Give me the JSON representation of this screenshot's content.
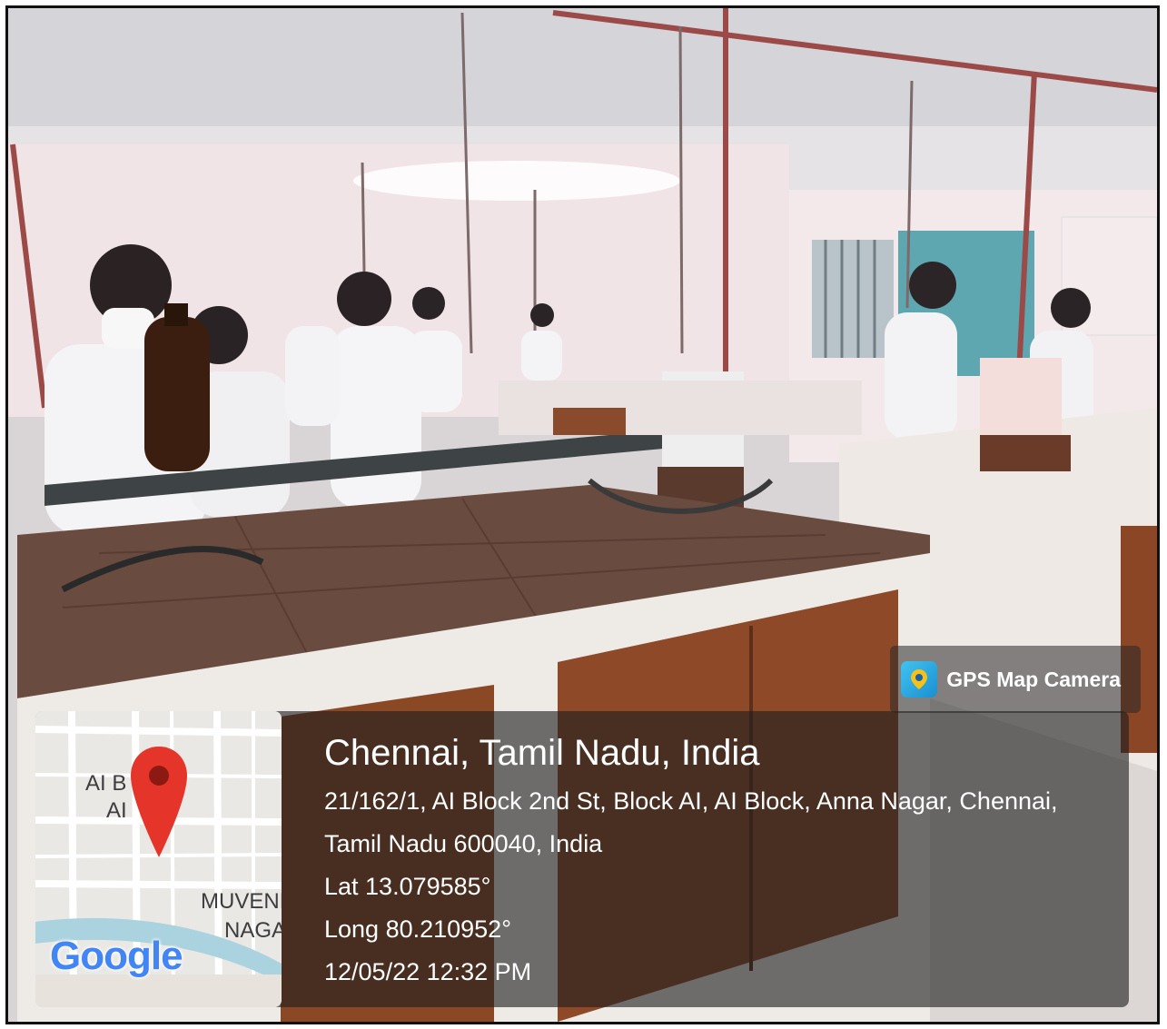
{
  "badge": {
    "app_name": "GPS Map Camera",
    "logo_icon": "camera-pin-icon"
  },
  "map": {
    "label_1": "AI B",
    "label_2": "AI",
    "label_3": "MUVENI",
    "label_4": "NAGA",
    "provider": "Google",
    "marker_icon": "red-map-pin-icon"
  },
  "location": {
    "city": "Chennai, Tamil Nadu, India",
    "address": "21/162/1, AI Block 2nd St, Block AI, AI Block, Anna Nagar, Chennai, Tamil Nadu 600040, India",
    "lat": "Lat 13.079585°",
    "long": "Long 80.210952°",
    "datetime": "12/05/22 12:32 PM"
  }
}
